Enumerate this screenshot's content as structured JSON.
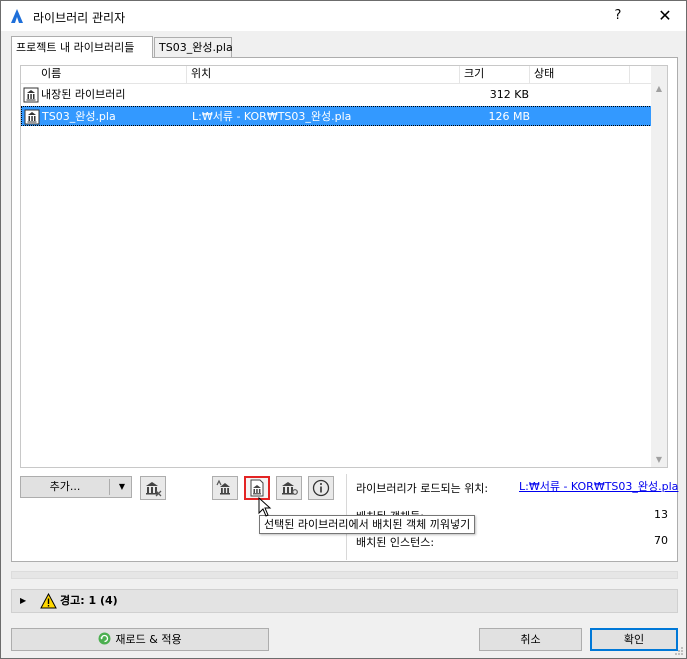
{
  "window": {
    "title": "라이브러리 관리자",
    "help_label": "?",
    "close_label": "✕"
  },
  "tabs": [
    {
      "label": "프로젝트 내 라이브러리들",
      "active": true
    },
    {
      "label": "TS03_완성.pla",
      "active": false
    }
  ],
  "list": {
    "columns": [
      "이름",
      "위치",
      "크기",
      "상태"
    ],
    "rows": [
      {
        "icon": "library-icon",
        "name": "내장된 라이브러리",
        "location": "",
        "size": "312 KB",
        "status": ""
      },
      {
        "icon": "library-file-icon",
        "name": "TS03_완성.pla",
        "location": "L:₩서류 - KOR₩TS03_완성.pla",
        "size": "126 MB",
        "status": "",
        "selected": true
      }
    ]
  },
  "toolbar": {
    "add_label": "추가...",
    "add_arrow": "▼",
    "tooltip": "선택된 라이브러리에서 배치된 객체 끼워넣기"
  },
  "info": {
    "load_location_label": "라이브러리가 로드되는 위치:",
    "load_location_value": "L:₩서류 - KOR₩TS03_완성.pla",
    "placed_objects_label": "배치된 객체들:",
    "placed_objects_value": "13",
    "placed_instances_label": "배치된 인스턴스:",
    "placed_instances_value": "70"
  },
  "warnings": {
    "toggle": "▶",
    "label": "경고: 1 (4)"
  },
  "buttons": {
    "reload_apply": "재로드 & 적용",
    "cancel": "취소",
    "ok": "확인"
  },
  "colors": {
    "selection": "#3399ff",
    "highlight_border": "#e32424",
    "link": "#0000ee",
    "warning": "#ffd800"
  }
}
